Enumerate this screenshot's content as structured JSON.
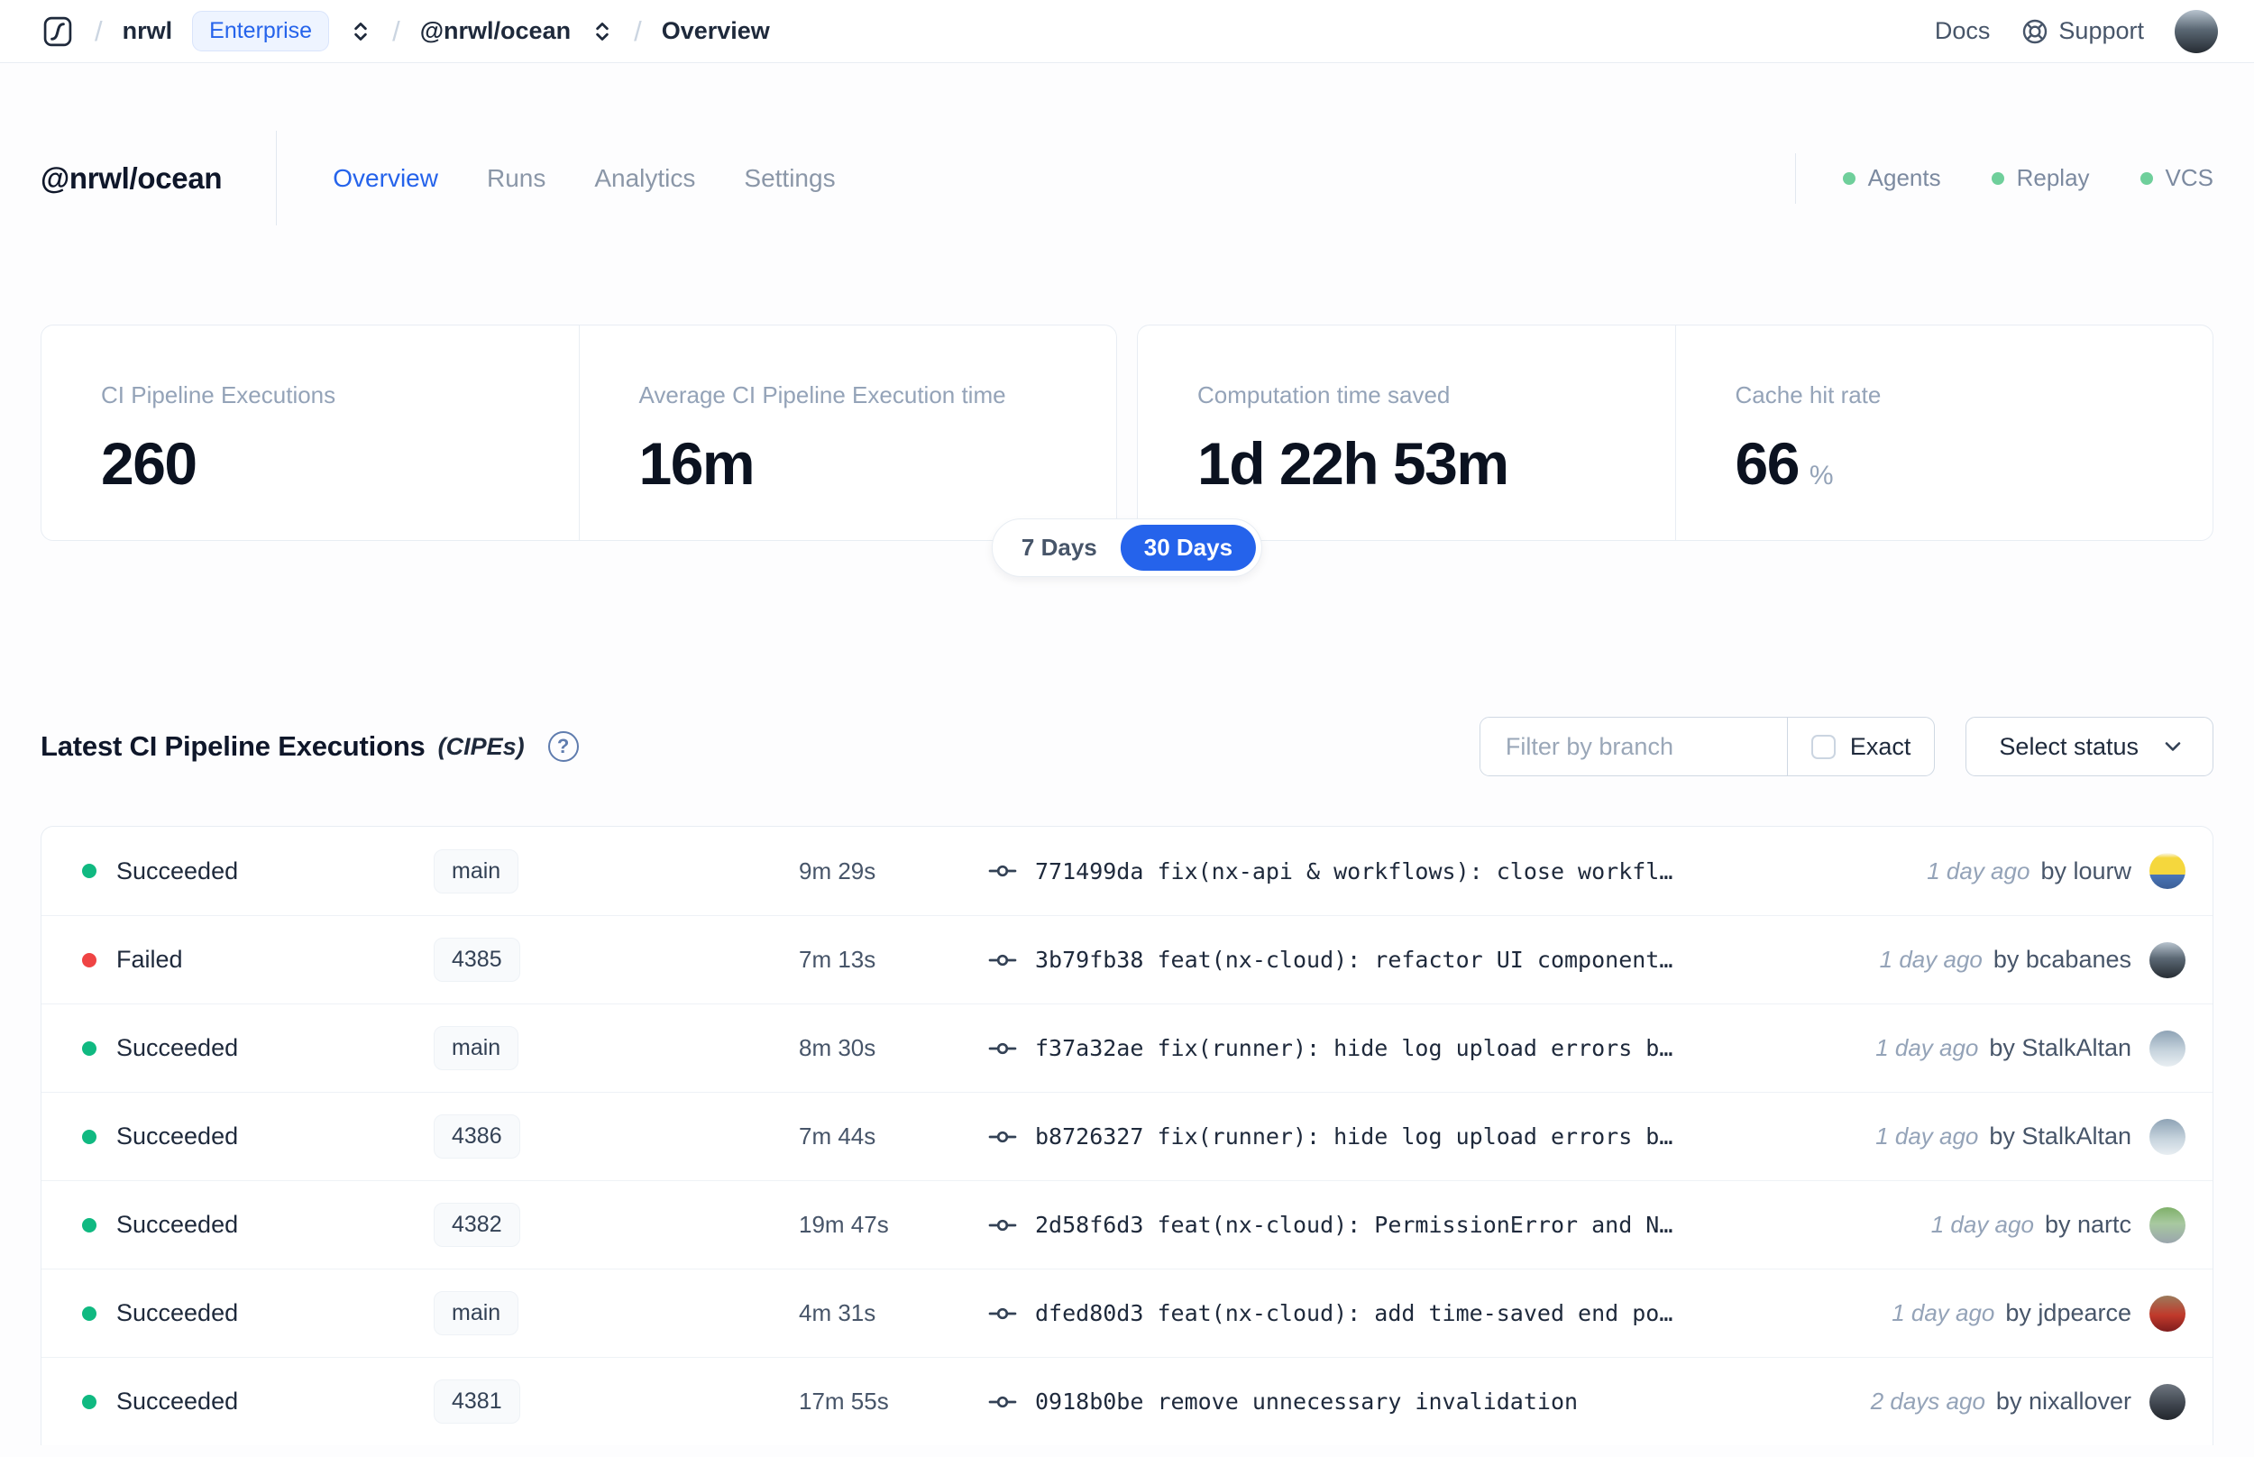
{
  "nav": {
    "separator": "/",
    "org": "nrwl",
    "org_badge": "Enterprise",
    "workspace": "@nrwl/ocean",
    "page": "Overview",
    "docs_label": "Docs",
    "support_label": "Support"
  },
  "workspace": {
    "title": "@nrwl/ocean",
    "tabs": [
      {
        "label": "Overview",
        "active": true
      },
      {
        "label": "Runs",
        "active": false
      },
      {
        "label": "Analytics",
        "active": false
      },
      {
        "label": "Settings",
        "active": false
      }
    ],
    "status_links": [
      {
        "label": "Agents"
      },
      {
        "label": "Replay"
      },
      {
        "label": "VCS"
      }
    ]
  },
  "stats": {
    "cards": [
      {
        "label": "CI Pipeline Executions",
        "value": "260",
        "suffix": ""
      },
      {
        "label": "Average CI Pipeline Execution time",
        "value": "16m",
        "suffix": ""
      },
      {
        "label": "Computation time saved",
        "value": "1d 22h 53m",
        "suffix": ""
      },
      {
        "label": "Cache hit rate",
        "value": "66",
        "suffix": "%"
      }
    ],
    "range_toggle": {
      "options": [
        "7 Days",
        "30 Days"
      ],
      "selected": "30 Days"
    }
  },
  "cipes": {
    "title": "Latest CI Pipeline Executions",
    "subtitle": "(CIPEs)",
    "help_glyph": "?",
    "filter_placeholder": "Filter by branch",
    "exact_label": "Exact",
    "status_select_label": "Select status",
    "rows": [
      {
        "status": "Succeeded",
        "status_key": "succeeded",
        "branch": "main",
        "duration": "9m 29s",
        "commit": "771499da fix(nx-api & workflows): close workfl…",
        "time": "1 day ago",
        "author": "by lourw",
        "avatar": "lourw"
      },
      {
        "status": "Failed",
        "status_key": "failed",
        "branch": "4385",
        "duration": "7m 13s",
        "commit": "3b79fb38 feat(nx-cloud): refactor UI component…",
        "time": "1 day ago",
        "author": "by bcabanes",
        "avatar": "bcabanes"
      },
      {
        "status": "Succeeded",
        "status_key": "succeeded",
        "branch": "main",
        "duration": "8m 30s",
        "commit": "f37a32ae fix(runner): hide log upload errors b…",
        "time": "1 day ago",
        "author": "by StalkAltan",
        "avatar": "stalkaltan"
      },
      {
        "status": "Succeeded",
        "status_key": "succeeded",
        "branch": "4386",
        "duration": "7m 44s",
        "commit": "b8726327 fix(runner): hide log upload errors b…",
        "time": "1 day ago",
        "author": "by StalkAltan",
        "avatar": "stalkaltan"
      },
      {
        "status": "Succeeded",
        "status_key": "succeeded",
        "branch": "4382",
        "duration": "19m 47s",
        "commit": "2d58f6d3 feat(nx-cloud): PermissionError and N…",
        "time": "1 day ago",
        "author": "by nartc",
        "avatar": "nartc"
      },
      {
        "status": "Succeeded",
        "status_key": "succeeded",
        "branch": "main",
        "duration": "4m 31s",
        "commit": "dfed80d3 feat(nx-cloud): add time-saved end po…",
        "time": "1 day ago",
        "author": "by jdpearce",
        "avatar": "jdpearce"
      },
      {
        "status": "Succeeded",
        "status_key": "succeeded",
        "branch": "4381",
        "duration": "17m 55s",
        "commit": "0918b0be remove unnecessary invalidation",
        "time": "2 days ago",
        "author": "by nixallover",
        "avatar": "nixallover"
      }
    ]
  },
  "colors": {
    "accent_blue": "#2563eb",
    "success_green": "#10b981",
    "failed_red": "#ef4444",
    "header_dot_green": "#6fcf9b"
  }
}
